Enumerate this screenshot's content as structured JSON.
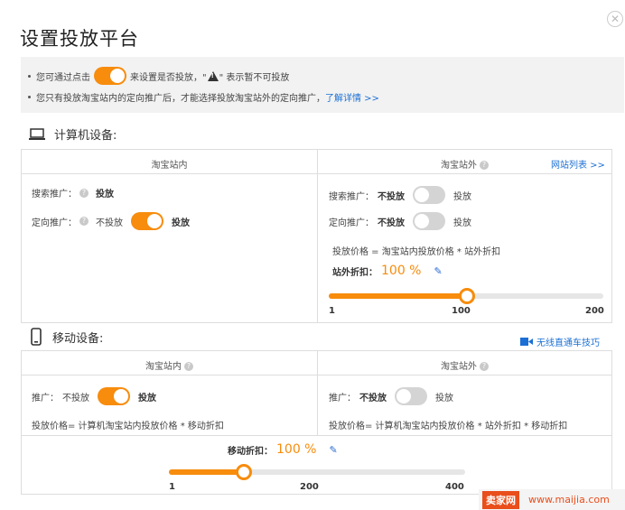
{
  "title": "设置投放平台",
  "notice": {
    "line1_a": "您可通过点击",
    "line1_b": "来设置是否投放，\"",
    "line1_c": "\" 表示暂不可投放",
    "line2": "您只有投放淘宝站内的定向推广后，才能选择投放淘宝站外的定向推广，",
    "line2_link": "了解详情 >>"
  },
  "pc": {
    "section_label": "计算机设备:",
    "inside": {
      "header": "淘宝站内",
      "search_label": "搜索推广：",
      "search_value": "投放",
      "target_label": "定向推广：",
      "target_off": "不投放",
      "target_on": "投放"
    },
    "outside": {
      "header": "淘宝站外",
      "site_list_link": "网站列表 >>",
      "search_label": "搜索推广：",
      "search_off": "不投放",
      "search_on": "投放",
      "target_label": "定向推广：",
      "target_off": "不投放",
      "target_on": "投放",
      "price_formula": "投放价格 = 淘宝站内投放价格 * 站外折扣",
      "discount_label": "站外折扣：",
      "discount_value": "100 %",
      "slider": {
        "min": "1",
        "mid": "100",
        "max": "200",
        "value_fraction": 0.5
      }
    }
  },
  "mobile": {
    "section_label": "移动设备:",
    "tips_link": "无线直通车技巧",
    "inside": {
      "header": "淘宝站内",
      "promo_label": "推广：",
      "off": "不投放",
      "on": "投放",
      "price_formula": "投放价格= 计算机淘宝站内投放价格 * 移动折扣"
    },
    "outside": {
      "header": "淘宝站外",
      "promo_label": "推广：",
      "off": "不投放",
      "on": "投放",
      "price_formula": "投放价格= 计算机淘宝站内投放价格 * 站外折扣 * 移动折扣"
    },
    "discount_label": "移动折扣：",
    "discount_value": "100 %",
    "slider": {
      "min": "1",
      "mid": "200",
      "max": "400",
      "value_fraction": 0.25
    }
  },
  "watermark": {
    "brand": "卖家网",
    "url": "www.maijia.com"
  },
  "colors": {
    "accent": "#f78c0d",
    "link": "#1b6fd4",
    "toggle_off": "#d4d4d4"
  }
}
